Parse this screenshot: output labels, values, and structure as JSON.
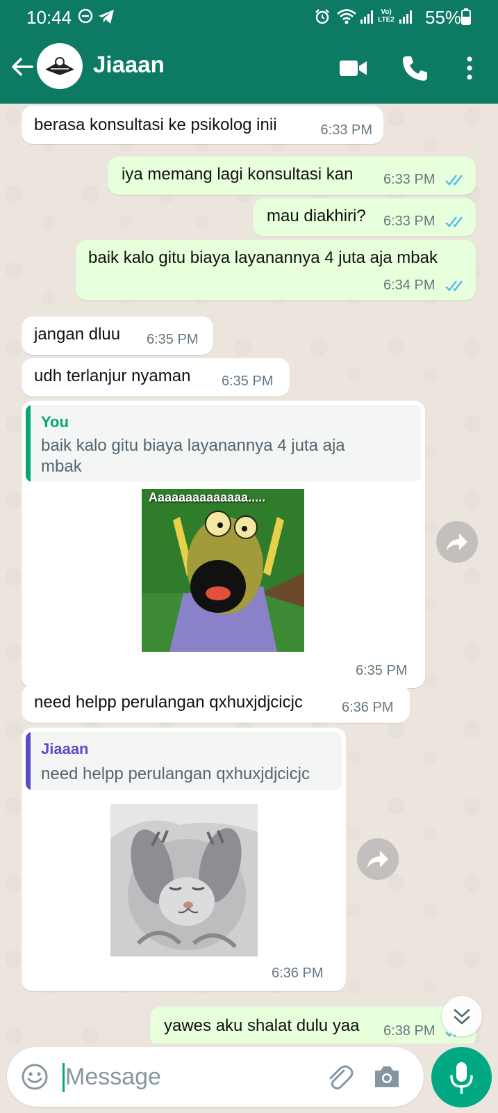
{
  "status_bar": {
    "time": "10:44",
    "battery": "55%",
    "network_label": "Vo) LTE2"
  },
  "header": {
    "contact_name": "Jiaaan"
  },
  "messages": [
    {
      "direction": "in",
      "text": "berasa konsultasi ke psikolog inii",
      "time": "6:33 PM"
    },
    {
      "direction": "out",
      "text": "iya memang lagi konsultasi kan",
      "time": "6:33 PM",
      "status": "read"
    },
    {
      "direction": "out",
      "text": "mau diakhiri?",
      "time": "6:33 PM",
      "status": "read"
    },
    {
      "direction": "out",
      "text": "baik kalo gitu biaya layanannya 4 juta aja mbak",
      "time": "6:34 PM",
      "status": "read"
    },
    {
      "direction": "in",
      "text": "jangan dluu",
      "time": "6:35 PM"
    },
    {
      "direction": "in",
      "text": "udh terlanjur nyaman",
      "time": "6:35 PM"
    },
    {
      "direction": "in",
      "type": "image-reply",
      "quote": {
        "author": "You",
        "text_line1": "baik kalo gitu biaya layanannya 4 juta aja",
        "text_line2": "mbak"
      },
      "image_caption": "Aaaaaaaaaaaaaa.....",
      "time": "6:35 PM"
    },
    {
      "direction": "in",
      "text": "need helpp perulangan qxhuxjdjcicjc",
      "time": "6:36 PM"
    },
    {
      "direction": "in",
      "type": "image-reply",
      "quote": {
        "author": "Jiaaan",
        "text_line1": "need helpp perulangan qxhuxjdjcicjc"
      },
      "time": "6:36 PM"
    },
    {
      "direction": "out",
      "text": "yawes aku shalat dulu yaa",
      "time": "6:38 PM",
      "status": "read"
    }
  ],
  "composer": {
    "placeholder": "Message"
  },
  "colors": {
    "header": "#0d7a64",
    "chat_background": "#ece5dd",
    "outgoing_bubble": "#e7ffdb",
    "incoming_bubble": "#ffffff",
    "read_ticks": "#53bdeb",
    "accent": "#00a884",
    "quote_you": "#06a66f",
    "quote_contact": "#5b4ac9"
  },
  "icons": {
    "back": "arrow-left-icon",
    "video": "video-camera-icon",
    "call": "phone-icon",
    "menu": "more-vertical-icon",
    "forward": "forward-arrow-icon",
    "emoji": "emoji-icon",
    "attach": "paperclip-icon",
    "camera": "camera-icon",
    "mic": "microphone-icon",
    "scroll": "chevrons-down-icon"
  }
}
